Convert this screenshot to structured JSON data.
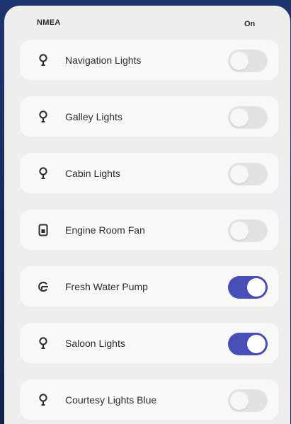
{
  "header": {
    "title": "NMEA",
    "on_label": "On"
  },
  "colors": {
    "accent": "#4a4fb8",
    "toggle_off": "#e2e2e0",
    "panel_bg": "#eeeeec",
    "screen_bg": "#1a2a5a"
  },
  "rows": [
    {
      "label": "Navigation Lights",
      "icon": "lightbulb-icon",
      "on": false
    },
    {
      "label": "Galley Lights",
      "icon": "lightbulb-icon",
      "on": false
    },
    {
      "label": "Cabin Lights",
      "icon": "lightbulb-icon",
      "on": false
    },
    {
      "label": "Engine Room Fan",
      "icon": "fan-device-icon",
      "on": false
    },
    {
      "label": "Fresh Water Pump",
      "icon": "water-pump-icon",
      "on": true
    },
    {
      "label": "Saloon Lights",
      "icon": "lightbulb-icon",
      "on": true
    },
    {
      "label": "Courtesy Lights Blue",
      "icon": "lightbulb-icon",
      "on": false
    }
  ]
}
